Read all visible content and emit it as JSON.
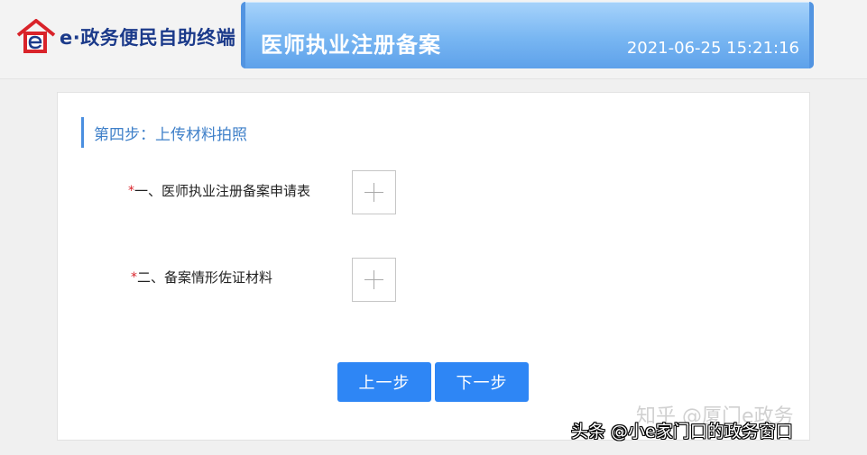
{
  "header": {
    "logo_text": "e·政务便民自助终端",
    "title": "医师执业注册备案",
    "datetime": "2021-06-25 15:21:16"
  },
  "step": {
    "title": "第四步：上传材料拍照"
  },
  "uploads": [
    {
      "required_mark": "*",
      "label": "一、医师执业注册备案申请表"
    },
    {
      "required_mark": "*",
      "label": "二、备案情形佐证材料"
    }
  ],
  "buttons": {
    "prev": "上一步",
    "next": "下一步"
  },
  "watermarks": {
    "faint": "知乎 @厦门e政务",
    "bottom": "头条 @小e家门口的政务窗口"
  },
  "colors": {
    "accent": "#2e86f5",
    "required": "#d9232a",
    "brand": "#1b3a8a",
    "banner": "#78b6f2"
  },
  "icons": {
    "logo": "house-e-logo-icon",
    "upload": "plus-icon"
  }
}
